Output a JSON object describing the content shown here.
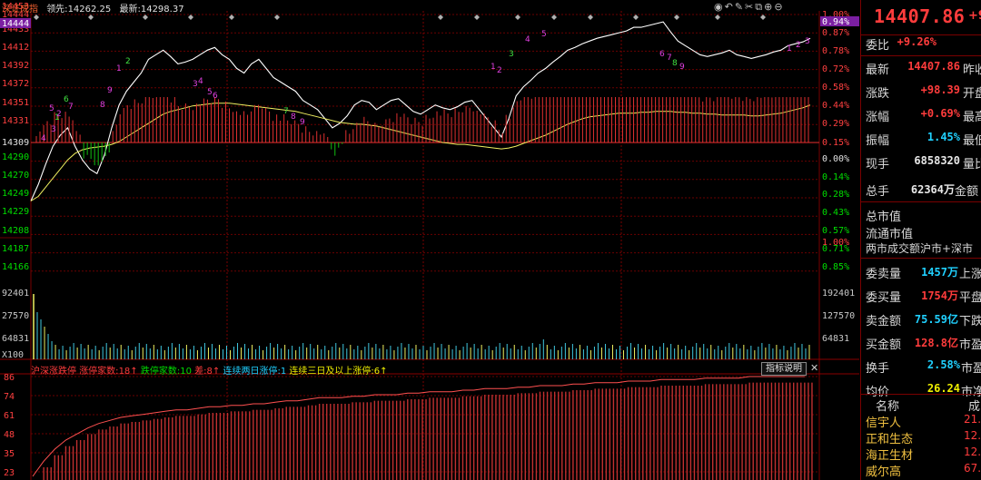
{
  "header": {
    "index_name": "深证成指",
    "leader_label": "领先:",
    "leader_value": "14262.25",
    "latest_label": "最新:",
    "latest_value": "14298.37"
  },
  "toolbar_icons": [
    "eye-icon",
    "undo-icon",
    "draw-icon",
    "scissors-icon",
    "copy-icon",
    "zoom-in-icon",
    "zoom-out-icon"
  ],
  "price_axis": {
    "left": [
      "14453",
      "14444",
      "14433",
      "14412",
      "14392",
      "14372",
      "14351",
      "14331",
      "14309",
      "14290",
      "14270",
      "14249",
      "14229",
      "14208",
      "14187",
      "14166"
    ],
    "left_current": "14444",
    "right": [
      "1.00%",
      "0.94%",
      "0.87%",
      "0.78%",
      "0.72%",
      "0.58%",
      "0.44%",
      "0.29%",
      "0.15%",
      "0.00%",
      "0.14%",
      "0.28%",
      "0.43%",
      "0.57%",
      "0.71%",
      "0.85%",
      "1.00%"
    ],
    "right_current": "0.94%"
  },
  "volume_axis": {
    "left": [
      "92401",
      "27570",
      "64831",
      "X100"
    ],
    "right": [
      "192401",
      "127570",
      "64831"
    ]
  },
  "limit_bar": {
    "title": "沪深涨跌停",
    "up_label": "涨停家数:",
    "up_value": "18↑",
    "down_label": "跌停家数:",
    "down_value": "10",
    "diff_label": "差:",
    "diff_value": "8↑",
    "two_day_label": "连续两日涨停:",
    "two_day_value": "1",
    "three_day_label": "连续三日及以上涨停:",
    "three_day_value": "6↑",
    "explain_button": "指标说明",
    "close_glyph": "✕"
  },
  "limit_axis": [
    "86",
    "74",
    "61",
    "48",
    "35",
    "23"
  ],
  "chart_data": {
    "type": "line",
    "price_series": [
      14240,
      14258,
      14280,
      14300,
      14312,
      14320,
      14300,
      14285,
      14275,
      14270,
      14290,
      14320,
      14345,
      14360,
      14370,
      14380,
      14395,
      14400,
      14405,
      14398,
      14390,
      14392,
      14395,
      14400,
      14405,
      14408,
      14400,
      14395,
      14385,
      14380,
      14390,
      14395,
      14385,
      14375,
      14370,
      14365,
      14360,
      14350,
      14345,
      14340,
      14330,
      14320,
      14325,
      14333,
      14345,
      14350,
      14348,
      14340,
      14345,
      14350,
      14352,
      14345,
      14338,
      14335,
      14340,
      14345,
      14342,
      14340,
      14343,
      14348,
      14350,
      14340,
      14330,
      14320,
      14310,
      14330,
      14355,
      14365,
      14372,
      14380,
      14385,
      14392,
      14398,
      14405,
      14408,
      14412,
      14415,
      14418,
      14420,
      14422,
      14424,
      14426,
      14430,
      14430,
      14432,
      14434,
      14436,
      14425,
      14415,
      14410,
      14405,
      14400,
      14398,
      14400,
      14402,
      14405,
      14400,
      14398,
      14396,
      14398,
      14400,
      14403,
      14405,
      14410,
      14412,
      14414,
      14418
    ],
    "avg_series": [
      14240,
      14245,
      14255,
      14265,
      14275,
      14285,
      14292,
      14296,
      14298,
      14299,
      14300,
      14302,
      14305,
      14310,
      14315,
      14320,
      14325,
      14330,
      14335,
      14338,
      14340,
      14342,
      14344,
      14345,
      14346,
      14347,
      14347,
      14347,
      14346,
      14345,
      14344,
      14343,
      14342,
      14341,
      14340,
      14339,
      14338,
      14336,
      14334,
      14332,
      14330,
      14328,
      14326,
      14325,
      14324,
      14324,
      14323,
      14322,
      14320,
      14318,
      14316,
      14314,
      14312,
      14310,
      14308,
      14306,
      14304,
      14303,
      14302,
      14302,
      14301,
      14300,
      14299,
      14298,
      14297,
      14298,
      14300,
      14303,
      14306,
      14309,
      14312,
      14316,
      14320,
      14324,
      14327,
      14330,
      14332,
      14333,
      14334,
      14335,
      14336,
      14336,
      14336,
      14337,
      14337,
      14338,
      14338,
      14338,
      14337,
      14337,
      14336,
      14336,
      14335,
      14335,
      14334,
      14334,
      14334,
      14334,
      14333,
      14333,
      14334,
      14335,
      14336,
      14338,
      14340,
      14342,
      14345
    ],
    "limit_up_counts": [
      20,
      30,
      38,
      44,
      48,
      52,
      55,
      57,
      59,
      60,
      61,
      62,
      63,
      64,
      64,
      65,
      66,
      66,
      67,
      67,
      68,
      68,
      69,
      70,
      70,
      71,
      72,
      72,
      72,
      73,
      73,
      74,
      74,
      74,
      75,
      75,
      76,
      76,
      76,
      77,
      77,
      78,
      78,
      78,
      79,
      79,
      80,
      80,
      80,
      81,
      81,
      82,
      82,
      82,
      83,
      83,
      83,
      84,
      84,
      84,
      84,
      85,
      85,
      85,
      85,
      86,
      86,
      86,
      86,
      86,
      86
    ]
  }
}
